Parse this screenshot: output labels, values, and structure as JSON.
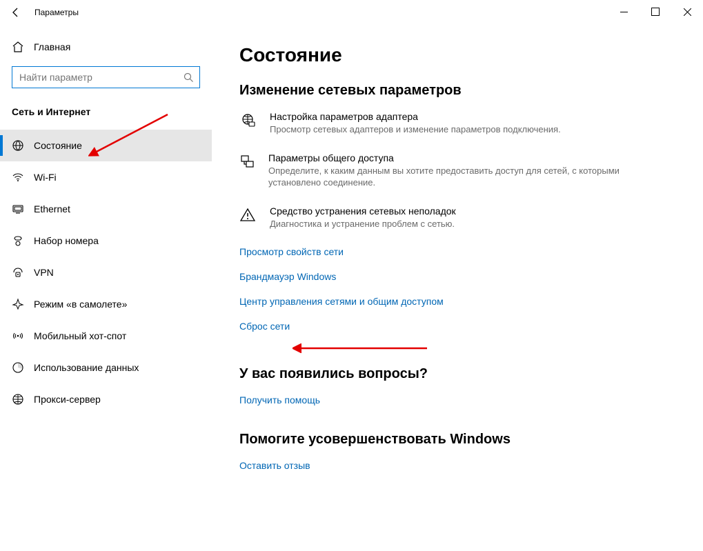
{
  "titlebar": {
    "title": "Параметры"
  },
  "sidebar": {
    "home": "Главная",
    "search_placeholder": "Найти параметр",
    "section": "Сеть и Интернет",
    "items": [
      {
        "label": "Состояние",
        "active": true
      },
      {
        "label": "Wi-Fi"
      },
      {
        "label": "Ethernet"
      },
      {
        "label": "Набор номера"
      },
      {
        "label": "VPN"
      },
      {
        "label": "Режим «в самолете»"
      },
      {
        "label": "Мобильный хот-спот"
      },
      {
        "label": "Использование данных"
      },
      {
        "label": "Прокси-сервер"
      }
    ]
  },
  "main": {
    "page_title": "Состояние",
    "section1_title": "Изменение сетевых параметров",
    "rows": [
      {
        "title": "Настройка параметров адаптера",
        "desc": "Просмотр сетевых адаптеров и изменение параметров подключения."
      },
      {
        "title": "Параметры общего доступа",
        "desc": "Определите, к каким данным вы хотите предоставить доступ для сетей, с которыми установлено соединение."
      },
      {
        "title": "Средство устранения сетевых неполадок",
        "desc": "Диагностика и устранение проблем с сетью."
      }
    ],
    "links": [
      "Просмотр свойств сети",
      "Брандмауэр Windows",
      "Центр управления сетями и общим доступом",
      "Сброс сети"
    ],
    "help_title": "У вас появились вопросы?",
    "help_link": "Получить помощь",
    "feedback_title": "Помогите усовершенствовать Windows",
    "feedback_link": "Оставить отзыв"
  }
}
